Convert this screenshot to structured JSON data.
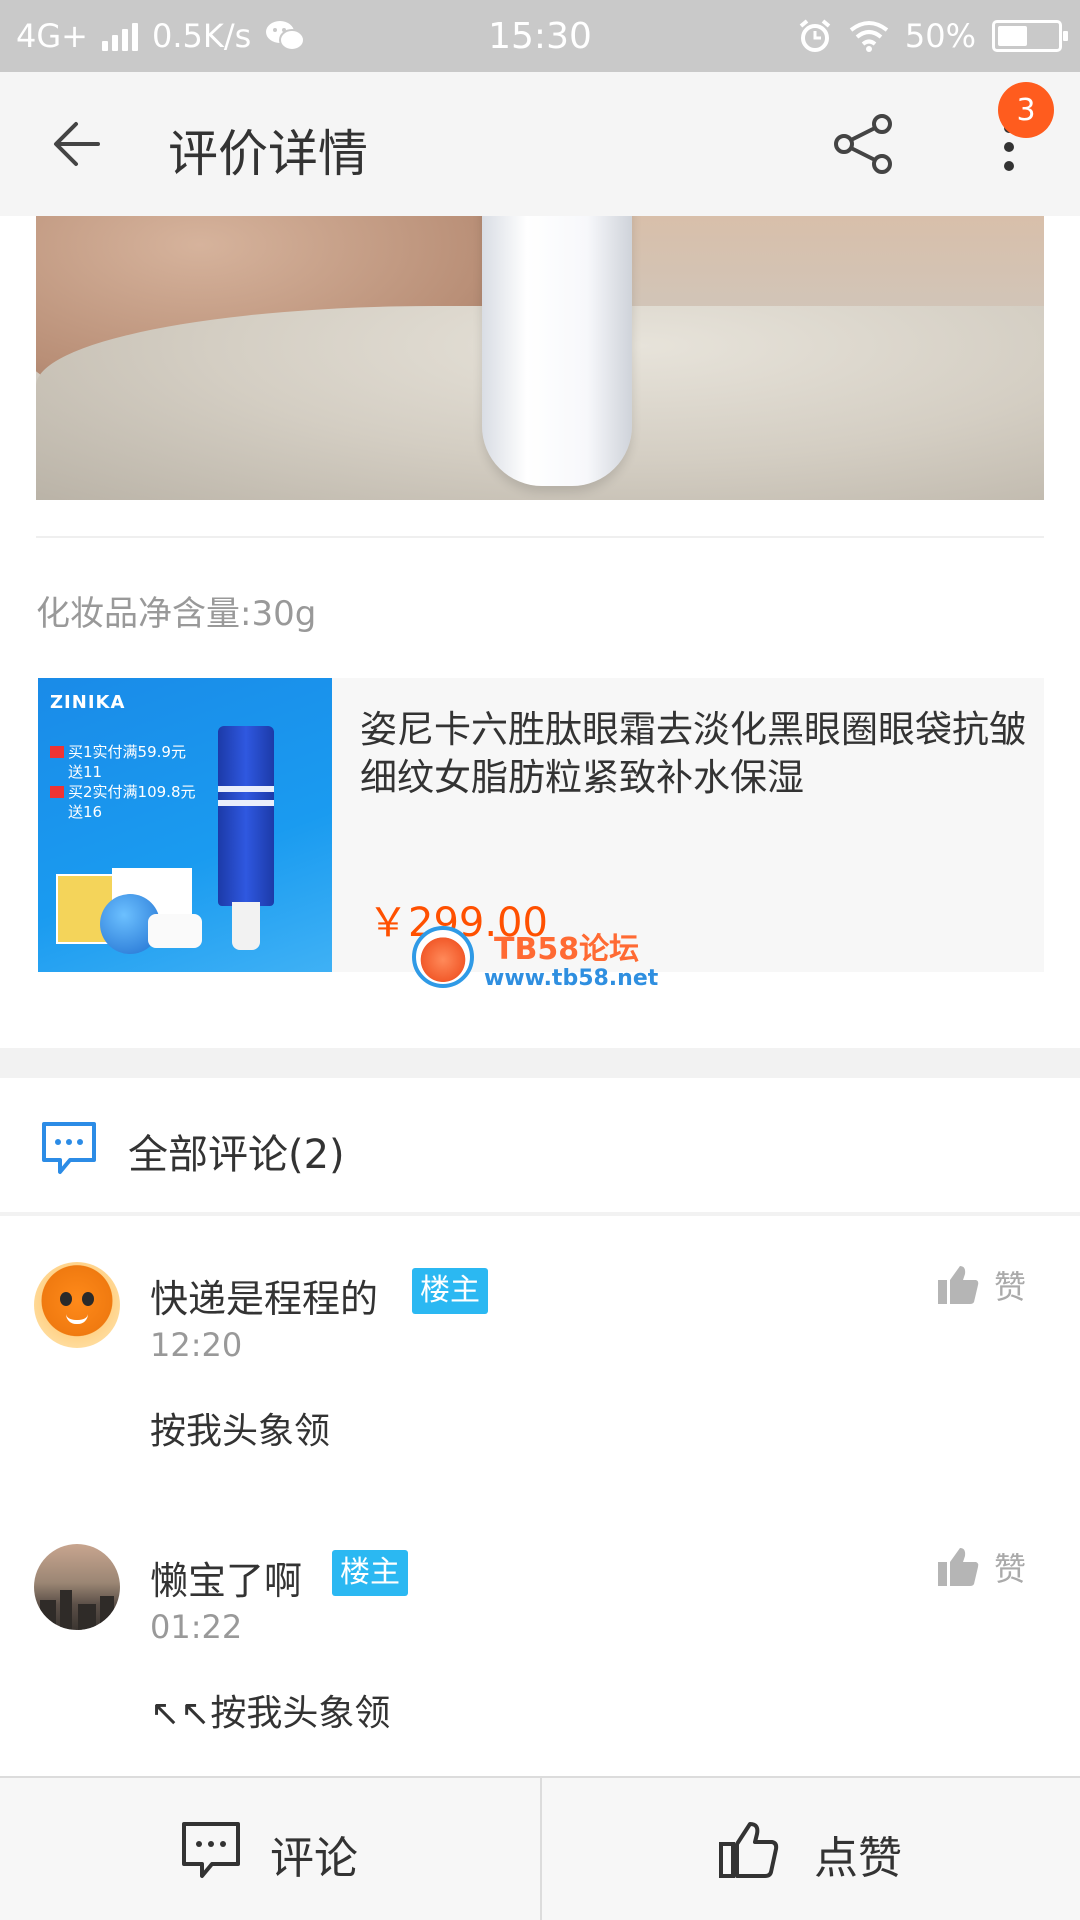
{
  "status_bar": {
    "network": "4G+",
    "speed": "0.5K/s",
    "time": "15:30",
    "battery": "50%",
    "battery_level": 0.5
  },
  "nav": {
    "title": "评价详情",
    "badge_count": "3",
    "icons": [
      "back-arrow-icon",
      "share-icon",
      "more-vertical-icon"
    ]
  },
  "review": {
    "spec": "化妆品净含量:30g"
  },
  "product": {
    "brand": "ZINIKA",
    "promo_lines": [
      "买1实付满59.9元",
      "送11",
      "买2实付满109.8元",
      "送16"
    ],
    "title": "姿尼卡六胜肽眼霜去淡化黑眼圈眼袋抗皱细纹女脂肪粒紧致补水保湿",
    "price": "￥299.00"
  },
  "watermark": {
    "title": "TB58论坛",
    "url": "www.tb58.net"
  },
  "comments": {
    "header": "全部评论(2)",
    "items": [
      {
        "name": "快递是程程的",
        "badge": "楼主",
        "time": "12:20",
        "body": "按我头象领",
        "like_label": "赞"
      },
      {
        "name": "懒宝了啊",
        "badge": "楼主",
        "time": "01:22",
        "body": "↖↖按我头象领",
        "like_label": "赞"
      }
    ]
  },
  "bottom_bar": {
    "comment_label": "评论",
    "like_label": "点赞"
  },
  "colors": {
    "accent_price": "#ff5000",
    "badge_bg": "#2bb8f2",
    "notification_badge": "#ff5c1e",
    "status_bar_bg": "#c9c9c9"
  }
}
